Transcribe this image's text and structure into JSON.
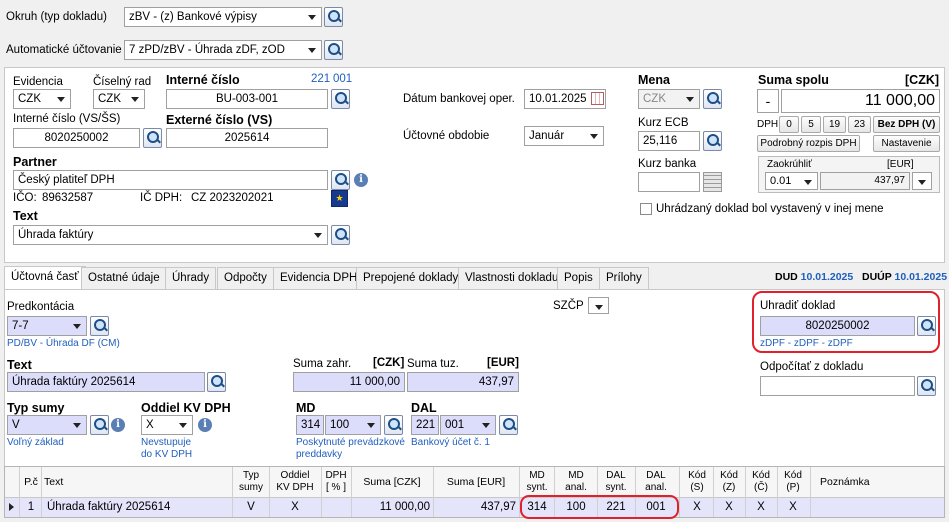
{
  "header": {
    "okruh_label": "Okruh (typ dokladu)",
    "okruh_value": "zBV - (z) Bankové výpisy",
    "auto_label": "Automatické účtovanie",
    "auto_value": "7 zPD/zBV - Úhrada zDF, zOD"
  },
  "doc": {
    "evidencia_label": "Evidencia",
    "evidencia_value": "CZK",
    "ciselny_rad_label": "Číselný rad",
    "ciselny_rad_value": "CZK",
    "interne_cislo_label": "Interné číslo",
    "interne_cislo_num1": "221",
    "interne_cislo_num2": "001",
    "interne_cislo_value": "BU-003-001",
    "interne_vs_label": "Interné číslo (VS/ŠS)",
    "interne_vs_value": "8020250002",
    "externe_label": "Externé číslo (VS)",
    "externe_value": "2025614",
    "partner_label": "Partner",
    "partner_value": "Český platiteľ DPH",
    "ico_label": "IČO:",
    "ico_value": "89632587",
    "icdph_label": "IČ DPH:",
    "icdph_value": "CZ 2023202021",
    "text_label": "Text",
    "text_value": "Úhrada faktúry",
    "datum_label": "Dátum bankovej oper.",
    "datum_value": "10.01.2025",
    "obdobie_label": "Účtovné obdobie",
    "obdobie_value": "Január",
    "mena_label": "Mena",
    "mena_value": "CZK",
    "kurz_ecb_label": "Kurz ECB",
    "kurz_ecb_value": "25,116",
    "kurz_banka_label": "Kurz banka",
    "kurz_banka_value": "",
    "uhradzany_label": "Uhrádzaný doklad bol vystavený v inej mene"
  },
  "suma": {
    "title": "Suma spolu",
    "currency": "[CZK]",
    "sign": "-",
    "value": "11 000,00",
    "dph_label": "DPH",
    "rates": [
      "0",
      "5",
      "19",
      "23"
    ],
    "bez_dph": "Bez DPH (V)",
    "rozpis": "Podrobný rozpis DPH",
    "nastavenie": "Nastavenie",
    "zaokruhlit_label": "Zaokrúhliť",
    "zaokruhlit_cur": "[EUR]",
    "zaokruhlit_value": "0.01",
    "zaokruhlit_amount": "437,97"
  },
  "tabs": [
    "Účtovná časť",
    "Ostatné údaje",
    "Úhrady",
    "Odpočty",
    "Evidencia DPH",
    "Prepojené doklady",
    "Vlastnosti dokladu",
    "Popis",
    "Prílohy"
  ],
  "dates": {
    "dud_label": "DUD",
    "dud_value": "10.01.2025",
    "duup_label": "DUÚP",
    "duup_value": "10.01.2025"
  },
  "posting": {
    "predkontacia_label": "Predkontácia",
    "predkontacia_value": "7-7",
    "predkontacia_desc": "PD/BV - Úhrada DF (CM)",
    "szcp_label": "SZČP",
    "uhradit_label": "Uhradiť doklad",
    "uhradit_value": "8020250002",
    "uhradit_desc": "zDPF - zDPF - zDPF",
    "text_label": "Text",
    "text_value": "Úhrada faktúry 2025614",
    "suma_zahr_label": "Suma zahr.",
    "suma_zahr_cur": "[CZK]",
    "suma_zahr_value": "11 000,00",
    "suma_tuz_label": "Suma tuz.",
    "suma_tuz_cur": "[EUR]",
    "suma_tuz_value": "437,97",
    "odpocitat_label": "Odpočítať z dokladu",
    "typ_sumy_label": "Typ sumy",
    "typ_sumy_value": "V",
    "typ_sumy_desc": "Voľný základ",
    "oddiel_label": "Oddiel KV DPH",
    "oddiel_value": "X",
    "oddiel_desc1": "Nevstupuje",
    "oddiel_desc2": "do KV DPH",
    "md_label": "MD",
    "md_synt": "314",
    "md_anal": "100",
    "md_desc1": "Poskytnuté prevádzkové",
    "md_desc2": "preddavky",
    "dal_label": "DAL",
    "dal_synt": "221",
    "dal_anal": "001",
    "dal_desc": "Bankový účet č. 1"
  },
  "grid": {
    "headers": [
      [
        "P.č"
      ],
      [
        "Text"
      ],
      [
        "Typ",
        "sumy"
      ],
      [
        "Oddiel",
        "KV DPH"
      ],
      [
        "DPH",
        "[ % ]"
      ],
      [
        "Suma [CZK]"
      ],
      [
        "Suma [EUR]"
      ],
      [
        "MD",
        "synt."
      ],
      [
        "MD",
        "anal."
      ],
      [
        "DAL",
        "synt."
      ],
      [
        "DAL",
        "anal."
      ],
      [
        "Kód",
        "(S)"
      ],
      [
        "Kód",
        "(Z)"
      ],
      [
        "Kód",
        "(Č)"
      ],
      [
        "Kód",
        "(P)"
      ],
      [
        "Poznámka"
      ]
    ],
    "row": {
      "pc": "1",
      "text": "Úhrada faktúry 2025614",
      "typ": "V",
      "oddiel": "X",
      "dph": "",
      "suma_czk": "11 000,00",
      "suma_eur": "437,97",
      "md_synt": "314",
      "md_anal": "100",
      "dal_synt": "221",
      "dal_anal": "001",
      "kod_s": "X",
      "kod_z": "X",
      "kod_c": "X",
      "kod_p": "X",
      "poznamka": ""
    }
  },
  "icons": {
    "lookup": "magnifier-icon",
    "info": "info-icon",
    "calendar": "calendar-icon",
    "calculator": "calculator-icon",
    "eu": "eu-flag-icon"
  },
  "colors": {
    "accent_blue": "#1f5fbf",
    "highlight_lavender": "#dcdcfb",
    "annotation_red": "#e0202a",
    "row_selected": "#e4e4fb"
  }
}
